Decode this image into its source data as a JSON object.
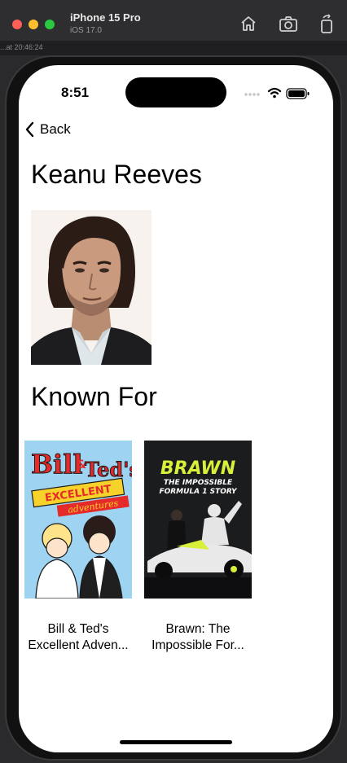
{
  "window": {
    "device": "iPhone 15 Pro",
    "os": "iOS 17.0",
    "behind_text": "...at 20:46:24"
  },
  "status": {
    "time": "8:51"
  },
  "nav": {
    "back_label": "Back"
  },
  "person": {
    "name": "Keanu Reeves"
  },
  "section": {
    "known_for": "Known For"
  },
  "posters": [
    {
      "title_line1": "Bill & Ted's",
      "title_line2": "Excellent Adven...",
      "art_text": [
        "Bill",
        "&",
        "Ted's",
        "EXCELLENT",
        "adventures"
      ]
    },
    {
      "title_line1": "Brawn: The",
      "title_line2": "Impossible For...",
      "art_text": [
        "BRAWN",
        "THE IMPOSSIBLE",
        "FORMULA 1 STORY"
      ]
    }
  ]
}
